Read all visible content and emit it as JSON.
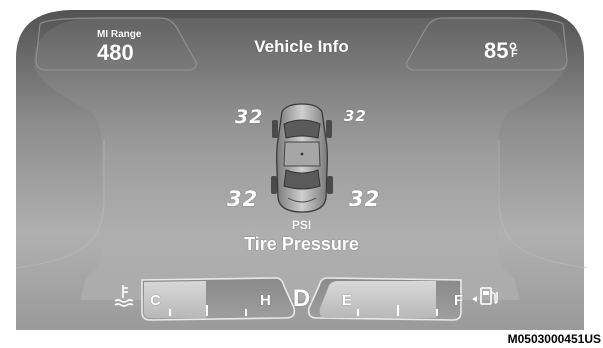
{
  "header": {
    "range_label": "MI Range",
    "range_value": "480",
    "title": "Vehicle Info",
    "outside_temp_value": "85°",
    "outside_temp_unit": "F"
  },
  "tire_pressure": {
    "front_left": "32",
    "front_right": "32",
    "rear_left": "32",
    "rear_right": "32",
    "unit": "PSI",
    "title": "Tire Pressure"
  },
  "gauges": {
    "coolant": {
      "icon": "coolant-temperature-icon",
      "low_label": "C",
      "high_label": "H"
    },
    "gear": "D",
    "fuel": {
      "icon": "fuel-pump-icon",
      "low_label": "E",
      "high_label": "F"
    }
  },
  "image_code": "M0503000451US",
  "colors": {
    "display_top": "#555555",
    "display_mid": "#a8a8a8",
    "gauge_fill": "#c8c8c8",
    "text": "#ffffff"
  }
}
